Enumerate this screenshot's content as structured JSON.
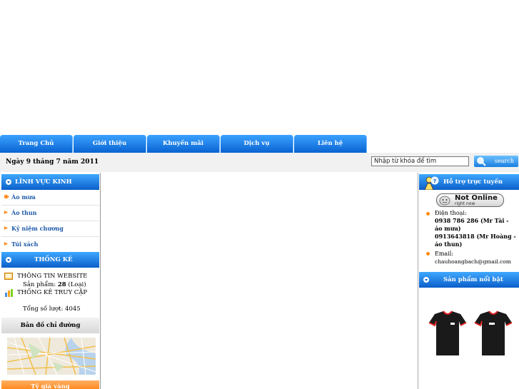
{
  "nav": {
    "tabs": [
      "Trang Chủ",
      "Giới thiệu",
      "Khuyến mãi",
      "Dịch vụ",
      "Liên hệ"
    ]
  },
  "date_text": "Ngày 9 tháng 7 năm 2011",
  "search": {
    "placeholder": "Nhập từ khóa để tìm",
    "button_label": "search"
  },
  "left": {
    "categories_title": "LĨNH VỰC KINH DOANH",
    "categories": [
      "Áo mưa",
      "Áo thun",
      "Kỷ niệm chương",
      "Túi xách"
    ],
    "stats_title": "THỐNG KÊ",
    "website_info_label": "THÔNG TIN WEBSITE",
    "products_prefix": "Sản phẩm:",
    "products_count": "28",
    "products_unit": "(Loại)",
    "access_stats_label": "THỐNG KÊ TRUY CẬP",
    "total_visits": "Tổng số lượt: 4045",
    "map_title": "Bản đồ chỉ đường",
    "gold_title": "Tỷ giá vàng"
  },
  "right": {
    "support_title": "Hỗ trợ trực tuyến",
    "status_main": "Not Online",
    "status_sub": "right now",
    "phone_label": "Điện thoại:",
    "phone_1": "0938 786 286 (Mr Tài - áo mưa)",
    "phone_2": "0913643818 (Mr Hoàng - áo thun)",
    "email_label": "Email:",
    "email_value": "chauhoangbach@gmail.com",
    "featured_title": "Sản phẩm nổi bật"
  },
  "colors": {
    "nav_blue": "#0a63d2",
    "accent_orange": "#ff8a1f",
    "link_blue": "#1e5aa8"
  }
}
